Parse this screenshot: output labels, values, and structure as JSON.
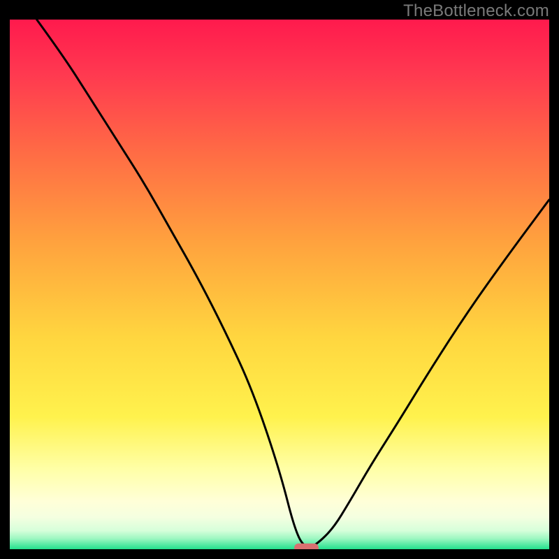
{
  "watermark": "TheBottleneck.com",
  "chart_data": {
    "type": "line",
    "title": "",
    "xlabel": "",
    "ylabel": "",
    "xlim": [
      0,
      100
    ],
    "ylim": [
      0,
      100
    ],
    "grid": false,
    "legend": false,
    "gradient_bands": [
      {
        "color_top": "#ff1a4d",
        "color_bottom": "#ff4747",
        "y0": 0,
        "y1": 18
      },
      {
        "color_top": "#ff4747",
        "color_bottom": "#ff8b3d",
        "y0": 18,
        "y1": 40
      },
      {
        "color_top": "#ff8b3d",
        "color_bottom": "#ffd23f",
        "y0": 40,
        "y1": 62
      },
      {
        "color_top": "#ffd23f",
        "color_bottom": "#fff34f",
        "y0": 62,
        "y1": 78
      },
      {
        "color_top": "#fff34f",
        "color_bottom": "#ffffb3",
        "y0": 78,
        "y1": 90
      },
      {
        "color_top": "#ffffb3",
        "color_bottom": "#e6ffc9",
        "y0": 90,
        "y1": 96
      },
      {
        "color_top": "#c9ffd1",
        "color_bottom": "#2bf598",
        "y0": 96,
        "y1": 100
      }
    ],
    "series": [
      {
        "name": "bottleneck-curve",
        "stroke": "#000000",
        "x": [
          5,
          10,
          15,
          20,
          25,
          30,
          35,
          40,
          45,
          50,
          53,
          55,
          57,
          60,
          63,
          67,
          72,
          78,
          85,
          92,
          100
        ],
        "y": [
          100,
          93,
          85,
          77,
          69,
          60,
          51,
          41,
          30,
          15,
          3,
          0,
          1,
          4,
          9,
          16,
          24,
          34,
          45,
          55,
          66
        ]
      }
    ],
    "marker": {
      "name": "optimal-point",
      "shape": "rounded-rect",
      "fill": "#d97070",
      "cx": 55,
      "cy": 0,
      "w": 4.5,
      "h": 2.2
    }
  }
}
